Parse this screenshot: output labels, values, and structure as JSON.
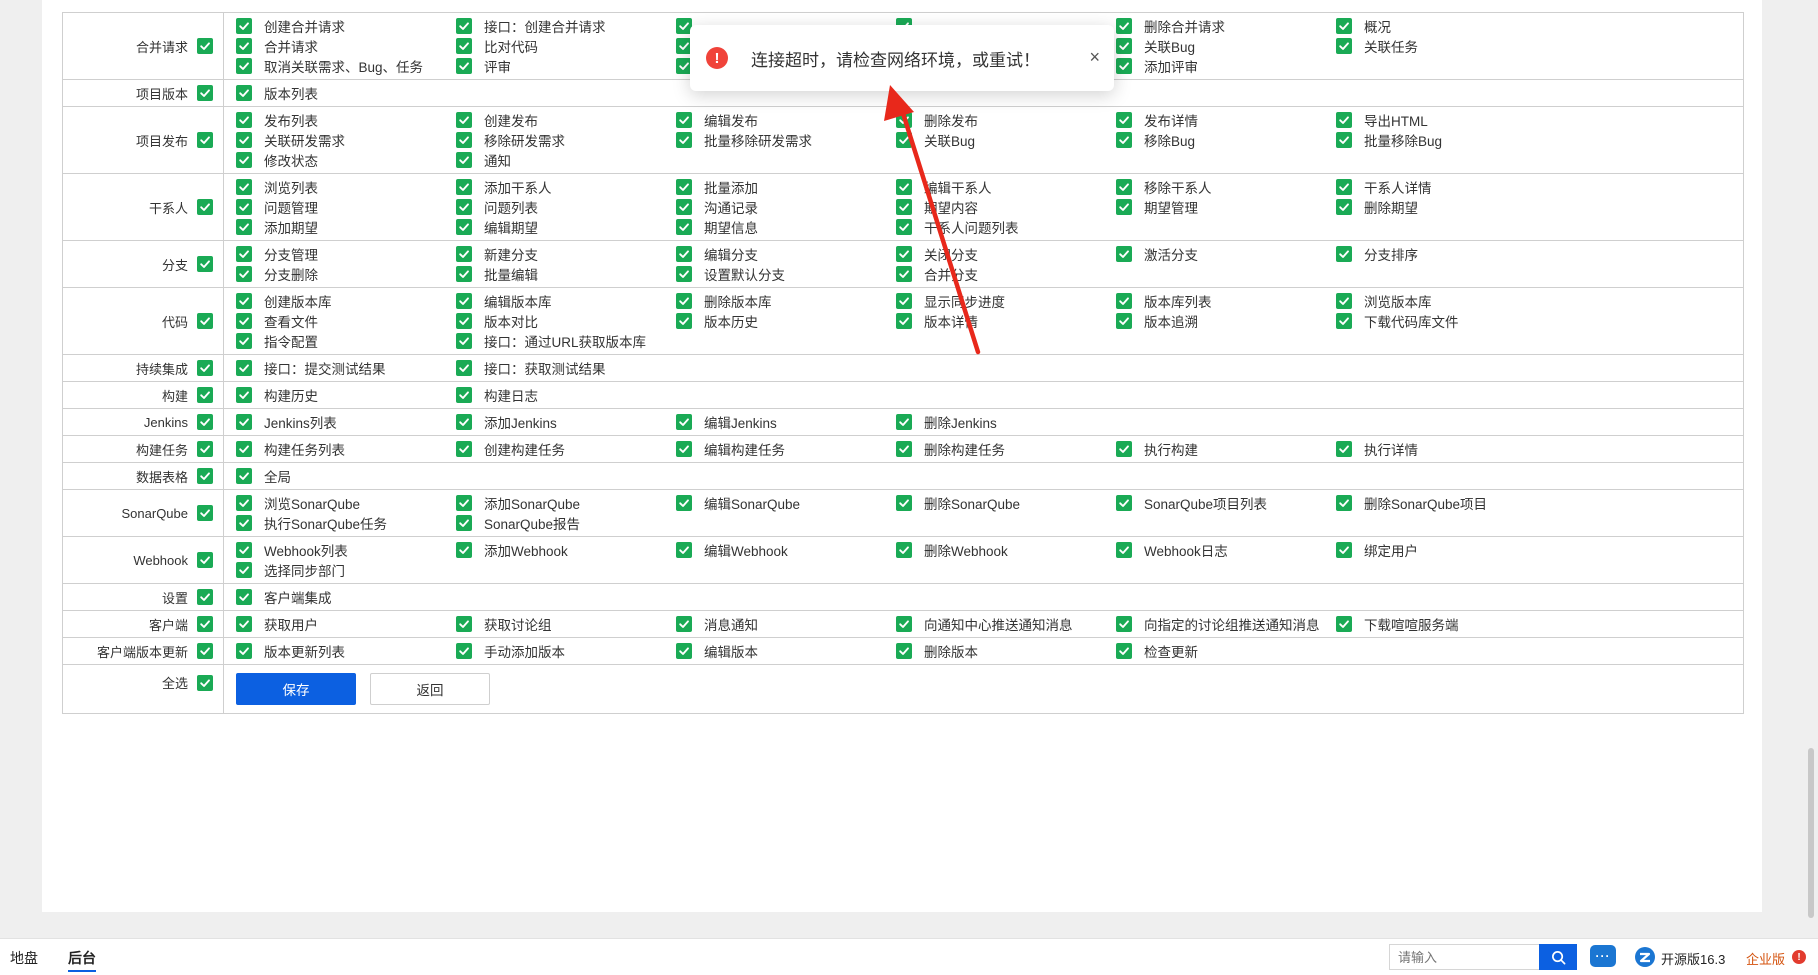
{
  "toast": {
    "message": "连接超时，请检查网络环境，或重试！",
    "close_symbol": "×",
    "warn_symbol": "!"
  },
  "rows": [
    {
      "module": "合并请求",
      "methods": [
        "创建合并请求",
        "接口：创建合并请求",
        "",
        "",
        "删除合并请求",
        "概况",
        "合并请求",
        "比对代码",
        "",
        "",
        "关联Bug",
        "关联任务",
        "取消关联需求、Bug、任务",
        "评审",
        "",
        "",
        "添加评审"
      ]
    },
    {
      "module": "项目版本",
      "methods": [
        "版本列表"
      ]
    },
    {
      "module": "项目发布",
      "methods": [
        "发布列表",
        "创建发布",
        "编辑发布",
        "删除发布",
        "发布详情",
        "导出HTML",
        "关联研发需求",
        "移除研发需求",
        "批量移除研发需求",
        "关联Bug",
        "移除Bug",
        "批量移除Bug",
        "修改状态",
        "通知"
      ]
    },
    {
      "module": "干系人",
      "methods": [
        "浏览列表",
        "添加干系人",
        "批量添加",
        "编辑干系人",
        "移除干系人",
        "干系人详情",
        "问题管理",
        "问题列表",
        "沟通记录",
        "期望内容",
        "期望管理",
        "删除期望",
        "添加期望",
        "编辑期望",
        "期望信息",
        "干系人问题列表"
      ]
    },
    {
      "module": "分支",
      "methods": [
        "分支管理",
        "新建分支",
        "编辑分支",
        "关闭分支",
        "激活分支",
        "分支排序",
        "分支删除",
        "批量编辑",
        "设置默认分支",
        "合并分支"
      ]
    },
    {
      "module": "代码",
      "methods": [
        "创建版本库",
        "编辑版本库",
        "删除版本库",
        "显示同步进度",
        "版本库列表",
        "浏览版本库",
        "查看文件",
        "版本对比",
        "版本历史",
        "版本详情",
        "版本追溯",
        "下载代码库文件",
        "指令配置",
        "接口：通过URL获取版本库"
      ]
    },
    {
      "module": "持续集成",
      "methods": [
        "接口：提交测试结果",
        "接口：获取测试结果"
      ]
    },
    {
      "module": "构建",
      "methods": [
        "构建历史",
        "构建日志"
      ]
    },
    {
      "module": "Jenkins",
      "methods": [
        "Jenkins列表",
        "添加Jenkins",
        "编辑Jenkins",
        "删除Jenkins"
      ]
    },
    {
      "module": "构建任务",
      "methods": [
        "构建任务列表",
        "创建构建任务",
        "编辑构建任务",
        "删除构建任务",
        "执行构建",
        "执行详情"
      ]
    },
    {
      "module": "数据表格",
      "methods": [
        "全局"
      ]
    },
    {
      "module": "SonarQube",
      "methods": [
        "浏览SonarQube",
        "添加SonarQube",
        "编辑SonarQube",
        "删除SonarQube",
        "SonarQube项目列表",
        "删除SonarQube项目",
        "执行SonarQube任务",
        "SonarQube报告"
      ]
    },
    {
      "module": "Webhook",
      "methods": [
        "Webhook列表",
        "添加Webhook",
        "编辑Webhook",
        "删除Webhook",
        "Webhook日志",
        "绑定用户",
        "选择同步部门"
      ]
    },
    {
      "module": "设置",
      "methods": [
        "客户端集成"
      ]
    },
    {
      "module": "客户端",
      "methods": [
        "获取用户",
        "获取讨论组",
        "消息通知",
        "向通知中心推送通知消息",
        "向指定的讨论组推送通知消息",
        "下载喧喧服务端"
      ]
    },
    {
      "module": "客户端版本更新",
      "methods": [
        "版本更新列表",
        "手动添加版本",
        "编辑版本",
        "删除版本",
        "检查更新"
      ]
    }
  ],
  "select_all": {
    "label": "全选"
  },
  "buttons": {
    "save": "保存",
    "back": "返回"
  },
  "footer": {
    "tabs": [
      "地盘",
      "后台"
    ],
    "active_tab": "后台",
    "search_placeholder": "请输入",
    "chat_icon_text": "···",
    "version": "开源版16.3",
    "enterprise": "企业版",
    "enterprise_badge": "!"
  },
  "colors": {
    "checkbox": "#1aaa55",
    "primary": "#0c60e1",
    "warning": "#f0433a",
    "annotation_arrow": "#e8281b",
    "enterprise": "#d4530e"
  }
}
